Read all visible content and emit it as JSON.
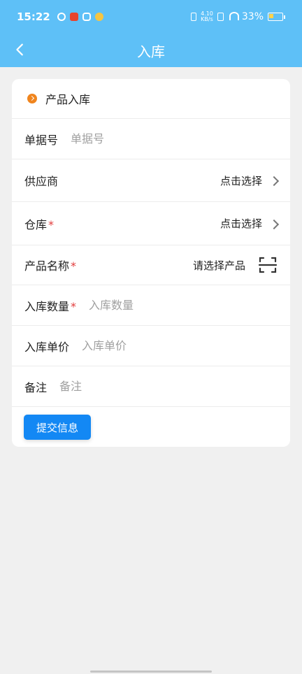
{
  "status_bar": {
    "time": "15:22",
    "net_speed_top": "4.10",
    "net_speed_bottom": "KB/s",
    "battery": "33%"
  },
  "nav": {
    "title": "入库"
  },
  "section": {
    "title": "产品入库"
  },
  "form": {
    "doc_no": {
      "label": "单据号",
      "placeholder": "单据号"
    },
    "supplier": {
      "label": "供应商",
      "value": "点击选择"
    },
    "warehouse": {
      "label": "仓库",
      "required": "*",
      "value": "点击选择"
    },
    "product": {
      "label": "产品名称",
      "required": "*",
      "value": "请选择产品"
    },
    "quantity": {
      "label": "入库数量",
      "required": "*",
      "placeholder": "入库数量"
    },
    "unit_price": {
      "label": "入库单价",
      "placeholder": "入库单价"
    },
    "remark": {
      "label": "备注",
      "placeholder": "备注"
    }
  },
  "submit": {
    "label": "提交信息"
  },
  "colors": {
    "header": "#5ec0f7",
    "primary": "#1388f4",
    "accent": "#f0851e",
    "required": "#e23b3b"
  }
}
